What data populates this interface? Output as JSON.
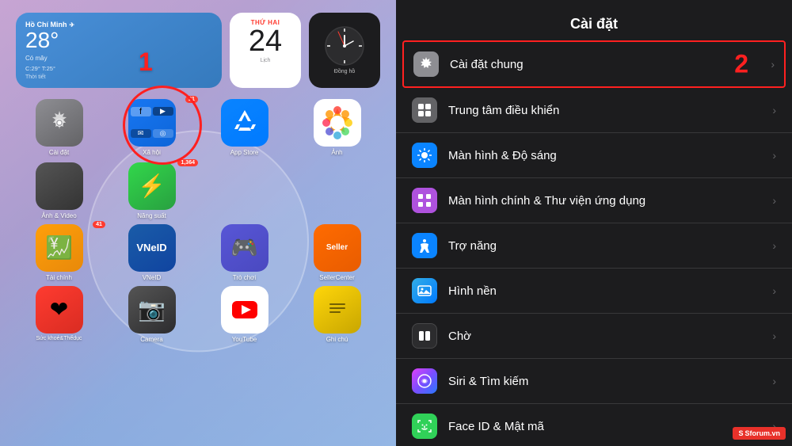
{
  "left": {
    "step_number": "1",
    "weather": {
      "city": "Hồ Chí Minh",
      "temp": "28°",
      "desc": "Có mây",
      "range": "C:29° T:25°",
      "label": "Thời tiết"
    },
    "calendar": {
      "day_label": "THỨ HAI",
      "date": "24",
      "label": "Lịch"
    },
    "clock": {
      "label": "Đồng hồ"
    },
    "apps": [
      {
        "name": "settings",
        "label": "Cài đặt",
        "icon": "⚙️",
        "style": "icon-settings",
        "badge": ""
      },
      {
        "name": "social",
        "label": "Xã hội",
        "icon": "📱",
        "style": "icon-social",
        "badge": "21"
      },
      {
        "name": "appstore",
        "label": "App Store",
        "icon": "🅰",
        "style": "icon-appstore",
        "badge": ""
      },
      {
        "name": "photos",
        "label": "Ảnh",
        "icon": "🖼",
        "style": "icon-photos",
        "badge": ""
      },
      {
        "name": "photo-video",
        "label": "Ảnh & Video",
        "icon": "📁",
        "style": "icon-photo-video",
        "badge": ""
      },
      {
        "name": "energy",
        "label": "Năng suất",
        "icon": "⚡",
        "style": "icon-energy",
        "badge": "1,364"
      },
      {
        "name": "finance",
        "label": "Tài chính",
        "icon": "💰",
        "style": "icon-finance",
        "badge": "41"
      },
      {
        "name": "vneid",
        "label": "VNeID",
        "icon": "🪪",
        "style": "icon-vneid",
        "badge": ""
      },
      {
        "name": "games",
        "label": "Trò chơi",
        "icon": "🎮",
        "style": "icon-games",
        "badge": ""
      },
      {
        "name": "seller",
        "label": "SellerCenter",
        "icon": "🛍",
        "style": "icon-seller",
        "badge": ""
      },
      {
        "name": "health",
        "label": "Sức khoẻ&Thểdục",
        "icon": "❤️",
        "style": "icon-health",
        "badge": ""
      },
      {
        "name": "camera",
        "label": "Camera",
        "icon": "📷",
        "style": "icon-camera",
        "badge": ""
      },
      {
        "name": "youtube",
        "label": "YouTube",
        "icon": "▶",
        "style": "icon-youtube",
        "badge": ""
      },
      {
        "name": "notes",
        "label": "Ghi chú",
        "icon": "📝",
        "style": "icon-notes",
        "badge": ""
      }
    ]
  },
  "right": {
    "title": "Cài đặt",
    "step_number": "2",
    "settings_items": [
      {
        "id": "general",
        "label": "Cài đặt chung",
        "icon": "⚙️",
        "icon_style": "si-gray",
        "highlighted": true
      },
      {
        "id": "control-center",
        "label": "Trung tâm điều khiển",
        "icon": "▣",
        "icon_style": "si-darkgray",
        "highlighted": false
      },
      {
        "id": "display",
        "label": "Màn hình & Độ sáng",
        "icon": "☀",
        "icon_style": "si-blue",
        "highlighted": false
      },
      {
        "id": "homescreen",
        "label": "Màn hình chính & Thư viện ứng dụng",
        "icon": "⊞",
        "icon_style": "si-purple",
        "highlighted": false
      },
      {
        "id": "accessibility",
        "label": "Trợ năng",
        "icon": "♿",
        "icon_style": "si-blue",
        "highlighted": false
      },
      {
        "id": "wallpaper",
        "label": "Hình nền",
        "icon": "🖼",
        "icon_style": "si-teal",
        "highlighted": false
      },
      {
        "id": "standby",
        "label": "Chờ",
        "icon": "⏱",
        "icon_style": "si-black",
        "highlighted": false
      },
      {
        "id": "siri",
        "label": "Siri & Tìm kiếm",
        "icon": "◉",
        "icon_style": "si-siri",
        "highlighted": false
      },
      {
        "id": "faceid",
        "label": "Face ID & Mật mã",
        "icon": "😊",
        "icon_style": "si-green",
        "highlighted": false
      }
    ]
  },
  "forum": {
    "badge_text": "Sforum.vn"
  }
}
